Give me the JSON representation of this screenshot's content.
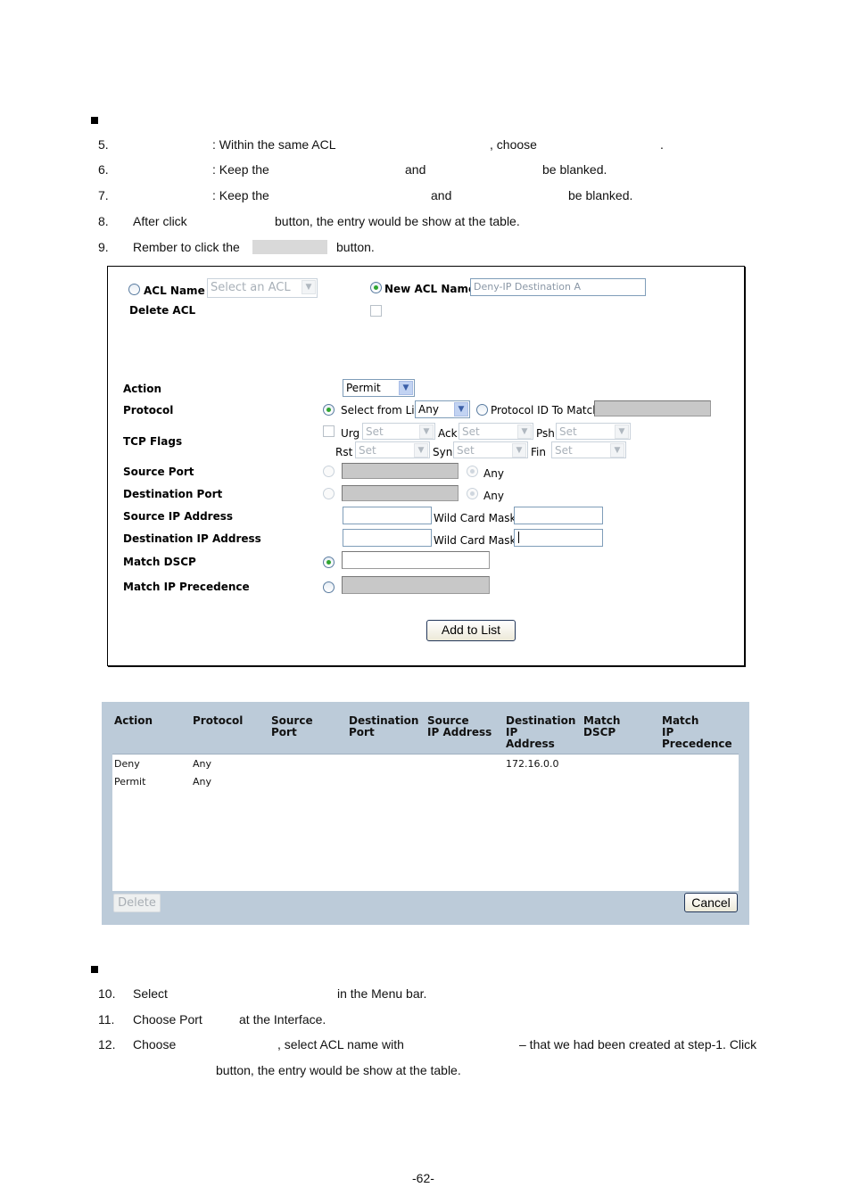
{
  "document": {
    "section1_steps": [
      {
        "num": "5.",
        "parts": [
          ": Within the same ACL",
          ", choose",
          "."
        ]
      },
      {
        "num": "6.",
        "parts": [
          ": Keep the",
          "and",
          "be blanked."
        ]
      },
      {
        "num": "7.",
        "parts": [
          ": Keep the",
          "and",
          "be blanked."
        ]
      },
      {
        "num": "8.",
        "parts": [
          "After click",
          "button, the entry would be show at the table."
        ]
      },
      {
        "num": "9.",
        "parts": [
          "Rember to click the",
          "button."
        ]
      }
    ],
    "section2_steps": [
      {
        "num": "10.",
        "parts": [
          "Select",
          "in the Menu bar."
        ]
      },
      {
        "num": "11.",
        "parts": [
          "Choose Port",
          "at the Interface."
        ]
      },
      {
        "num": "12.",
        "parts": [
          "Choose",
          ", select ACL name with",
          "– that we had been created at step-1. Click"
        ]
      },
      {
        "num": "",
        "parts": [
          "button, the entry would be show at the table."
        ]
      }
    ],
    "page_number": "-62-"
  },
  "form": {
    "acl_name_label": "ACL Name",
    "acl_name_select": "Select an ACL",
    "new_acl_name_label": "New ACL Name",
    "new_acl_name_value": "Deny-IP Destination A",
    "delete_acl_label": "Delete ACL",
    "action_label": "Action",
    "action_value": "Permit",
    "protocol_label": "Protocol",
    "select_from_list_label": "Select from List",
    "protocol_value": "Any",
    "protocol_id_label": "Protocol ID To Match",
    "tcp_flags_label": "TCP Flags",
    "flags": [
      {
        "name": "Urg",
        "value": "Set"
      },
      {
        "name": "Ack",
        "value": "Set"
      },
      {
        "name": "Psh",
        "value": "Set"
      },
      {
        "name": "Rst",
        "value": "Set"
      },
      {
        "name": "Syn",
        "value": "Set"
      },
      {
        "name": "Fin",
        "value": "Set"
      }
    ],
    "source_port_label": "Source Port",
    "destination_port_label": "Destination Port",
    "any_label": "Any",
    "source_ip_label": "Source IP Address",
    "destination_ip_label": "Destination IP Address",
    "wild_card_mask_label": "Wild Card Mask",
    "match_dscp_label": "Match DSCP",
    "match_ip_precedence_label": "Match IP Precedence",
    "add_to_list_button": "Add to List"
  },
  "table": {
    "headers": [
      [
        "Action"
      ],
      [
        "Protocol"
      ],
      [
        "Source",
        "Port"
      ],
      [
        "Destination",
        "Port"
      ],
      [
        "Source",
        "IP Address"
      ],
      [
        "Destination",
        "IP",
        "Address"
      ],
      [
        "Match",
        "DSCP"
      ],
      [
        "Match",
        "IP",
        "Precedence"
      ]
    ],
    "rows": [
      [
        "Deny",
        "Any",
        "",
        "",
        "",
        "172.16.0.0",
        "",
        ""
      ],
      [
        "Permit",
        "Any",
        "",
        "",
        "",
        "",
        "",
        ""
      ]
    ],
    "delete_button": "Delete",
    "cancel_button": "Cancel"
  },
  "colors": {
    "table_background": "#bccbd9",
    "radio_selected": "#2fa52f",
    "disabled_input": "#c8c8c8"
  }
}
